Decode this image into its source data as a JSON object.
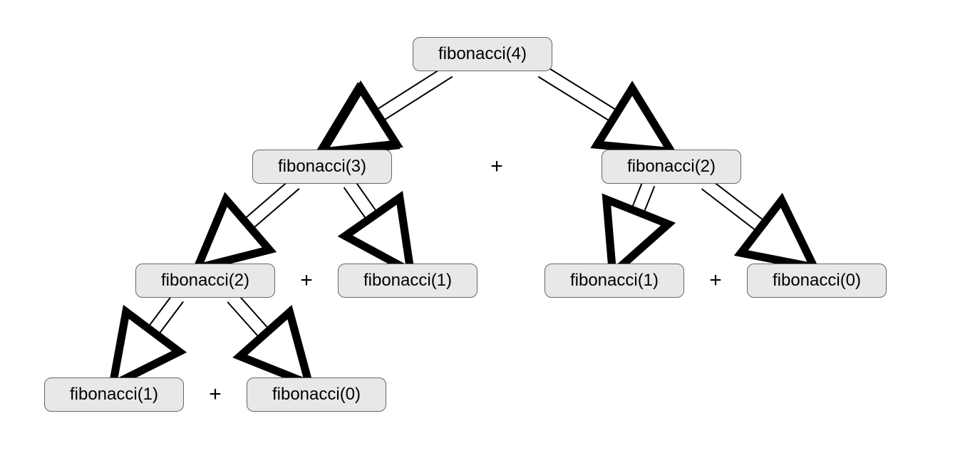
{
  "nodes": {
    "fib4": "fibonacci(4)",
    "fib3": "fibonacci(3)",
    "fib2a": "fibonacci(2)",
    "fib2b": "fibonacci(2)",
    "fib1a": "fibonacci(1)",
    "fib1b": "fibonacci(1)",
    "fib1c": "fibonacci(1)",
    "fib0a": "fibonacci(0)",
    "fib0b": "fibonacci(0)"
  },
  "operators": {
    "plus_row2": "+",
    "plus_row3_left": "+",
    "plus_row3_right": "+",
    "plus_row4": "+"
  }
}
